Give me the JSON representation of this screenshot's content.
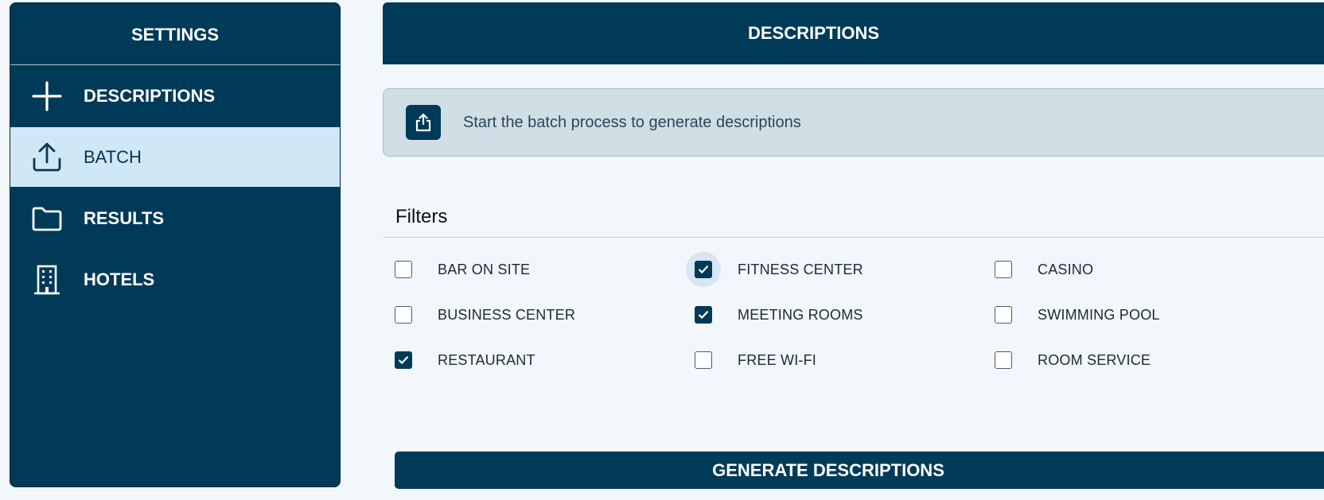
{
  "sidebar": {
    "title": "SETTINGS",
    "items": [
      {
        "label": "DESCRIPTIONS",
        "icon": "plus-icon"
      },
      {
        "label": "BATCH",
        "icon": "upload-icon",
        "active": true
      },
      {
        "label": "RESULTS",
        "icon": "folder-icon"
      },
      {
        "label": "HOTELS",
        "icon": "building-icon"
      }
    ]
  },
  "header": {
    "title": "DESCRIPTIONS"
  },
  "banner": {
    "icon": "share-upload-icon",
    "text": "Start the batch process to generate descriptions"
  },
  "filters": {
    "title": "Filters",
    "items": [
      {
        "label": "BAR ON SITE",
        "checked": false
      },
      {
        "label": "FITNESS CENTER",
        "checked": true,
        "focused": true
      },
      {
        "label": "CASINO",
        "checked": false
      },
      {
        "label": "BUSINESS CENTER",
        "checked": false
      },
      {
        "label": "MEETING ROOMS",
        "checked": true
      },
      {
        "label": "SWIMMING POOL",
        "checked": false
      },
      {
        "label": "RESTAURANT",
        "checked": true
      },
      {
        "label": "FREE WI-FI",
        "checked": false
      },
      {
        "label": "ROOM SERVICE",
        "checked": false
      }
    ]
  },
  "actions": {
    "generate_label": "GENERATE DESCRIPTIONS"
  },
  "colors": {
    "primary": "#003a59",
    "active_nav": "#d0e8f5",
    "background": "#f1f7fb",
    "banner": "#d0dee6"
  }
}
